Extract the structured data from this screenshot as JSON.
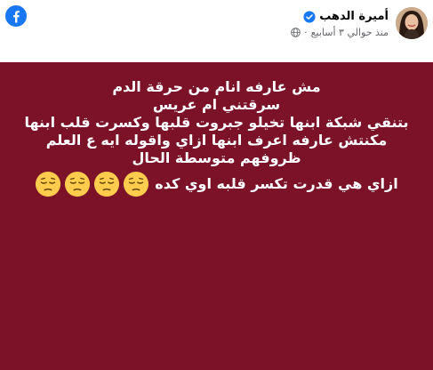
{
  "header": {
    "author_name": "أميرة الدهب",
    "timestamp": "منذ حوالي ٣ أسابيع",
    "colors": {
      "brand": "#1877f2",
      "name": "#050505",
      "meta": "#65676b"
    },
    "icons": {
      "logo": "facebook-logo-icon",
      "verified": "verified-badge-icon",
      "audience": "globe-icon"
    }
  },
  "post": {
    "background_color": "#7b1228",
    "text_color": "#ffffff",
    "lines": [
      "مش عارفه انام من حرقة الدم",
      "سرقتني ام عريس",
      "بتنقي شبكة ابنها تخيلو جبروت قلبها وكسرت قلب ابنها",
      "مكنتش عارفه اعرف ابنها ازاي واقوله ايه ع العلم",
      "ظروفهم متوسطة الحال"
    ],
    "last_line_text": "ازاي هي قدرت تكسر قلبه اوي كده",
    "last_line_emoji": "😔😔😔😔",
    "emoji_icon": "pensive-face-icon"
  }
}
